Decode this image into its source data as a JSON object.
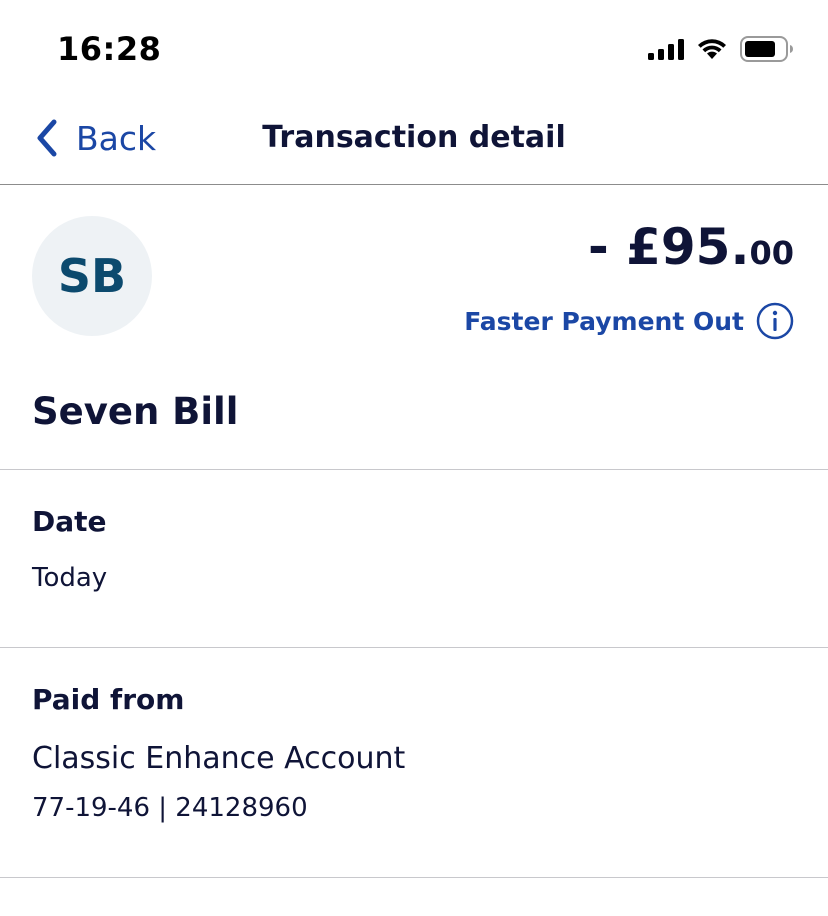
{
  "status_bar": {
    "time": "16:28",
    "icons": [
      "cellular-signal-icon",
      "wifi-icon",
      "battery-icon"
    ]
  },
  "nav": {
    "back_label": "Back",
    "title": "Transaction detail"
  },
  "transaction": {
    "avatar_initials": "SB",
    "amount_main": "- £95.",
    "amount_pence": "00",
    "payment_type": "Faster Payment Out",
    "payee_name": "Seven Bill"
  },
  "date_section": {
    "label": "Date",
    "value": "Today"
  },
  "paid_from_section": {
    "label": "Paid from",
    "account_name": "Classic Enhance Account",
    "account_details": "77-19-46 | 24128960"
  },
  "colors": {
    "accent_blue": "#1b47a5",
    "text_navy": "#0f1437",
    "avatar_bg": "#eef2f5",
    "avatar_text": "#0c4a6e"
  }
}
